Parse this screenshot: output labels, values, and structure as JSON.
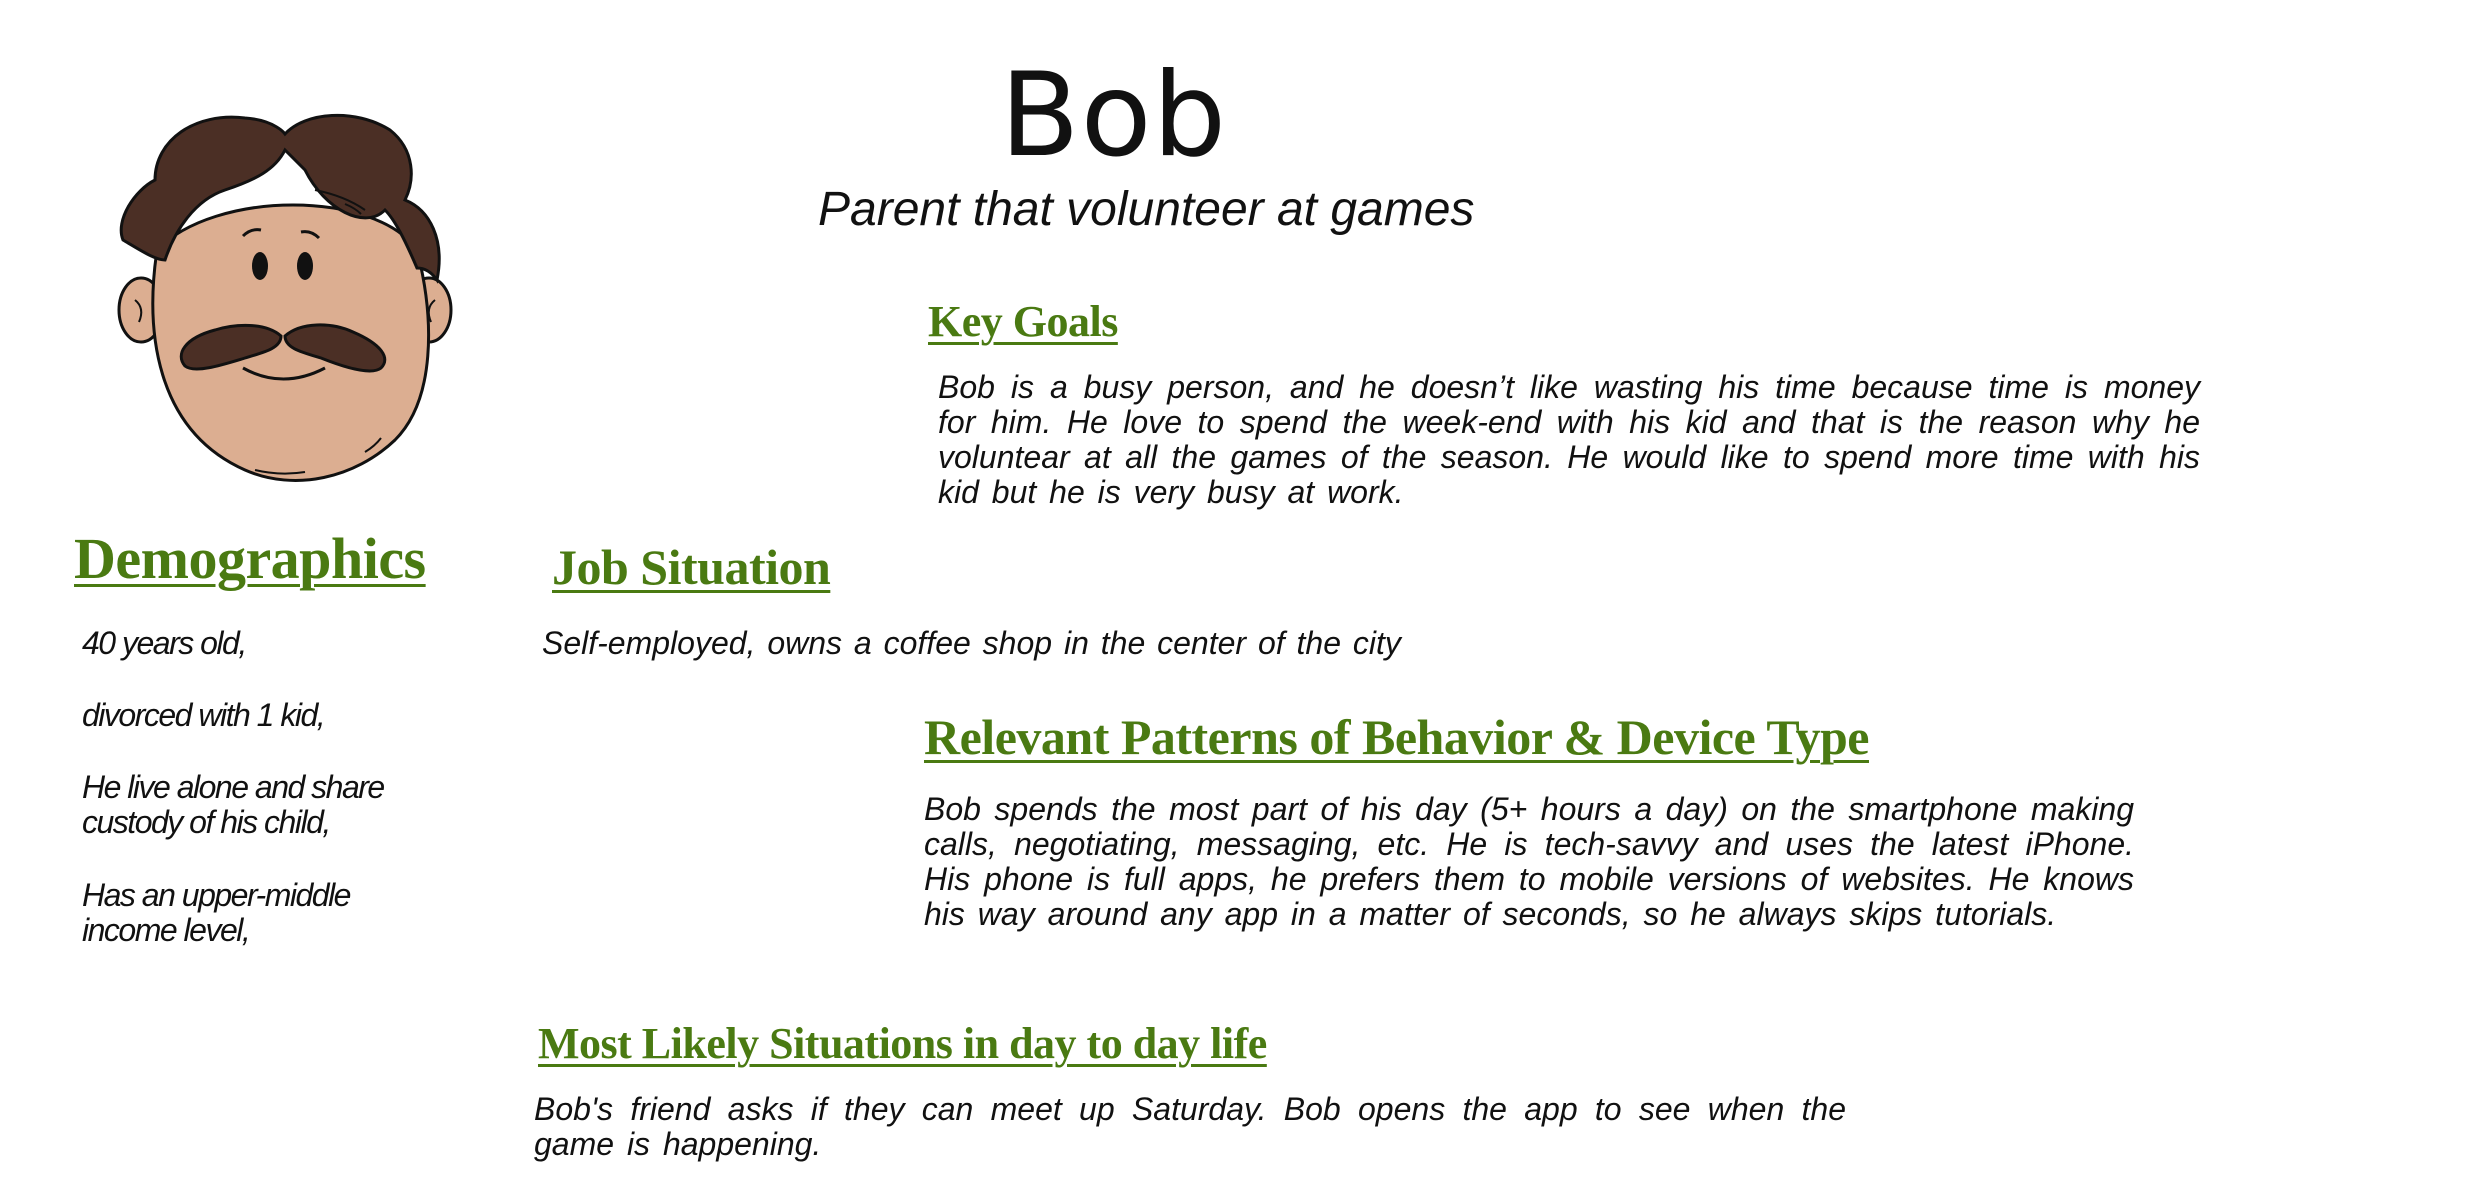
{
  "persona": {
    "name": "Bob",
    "role": "Parent that volunteer at games"
  },
  "avatar": {
    "icon": "cartoon-man-with-mustache-icon",
    "skin_color": "#dcae91",
    "hair_color": "#4b2f25",
    "outline_color": "#111111"
  },
  "colors": {
    "heading": "#4a7a12",
    "text": "#111111",
    "background": "#ffffff"
  },
  "key_goals": {
    "heading": "Key Goals",
    "text": "Bob is a busy person, and he doesn’t like wasting his time because time is money for him. He love to spend the week-end with his kid and that is the reason why he voluntear at all the games of the season. He would like to spend more time with his kid but he is very busy at work."
  },
  "demographics": {
    "heading": "Demographics",
    "items": [
      "40 years old,",
      "divorced with 1 kid,",
      "He live alone and share custody of his child,",
      "Has an upper-middle income level,"
    ]
  },
  "job_situation": {
    "heading": "Job Situation",
    "text": "Self-employed, owns a coffee shop in the center of the city"
  },
  "behavior": {
    "heading": "Relevant Patterns of Behavior & Device Type",
    "text": "Bob spends the most part of his day (5+ hours a day) on the smartphone making calls, negotiating, messaging, etc. He is tech-savvy and uses the latest iPhone. His phone is full apps, he prefers them to mobile versions of websites. He knows his way around any app in a matter of seconds, so he always skips tutorials."
  },
  "situations": {
    "heading": "Most Likely Situations in day to day life",
    "text": "Bob's friend asks if they can meet up Saturday. Bob opens the app to see when the game is happening."
  }
}
